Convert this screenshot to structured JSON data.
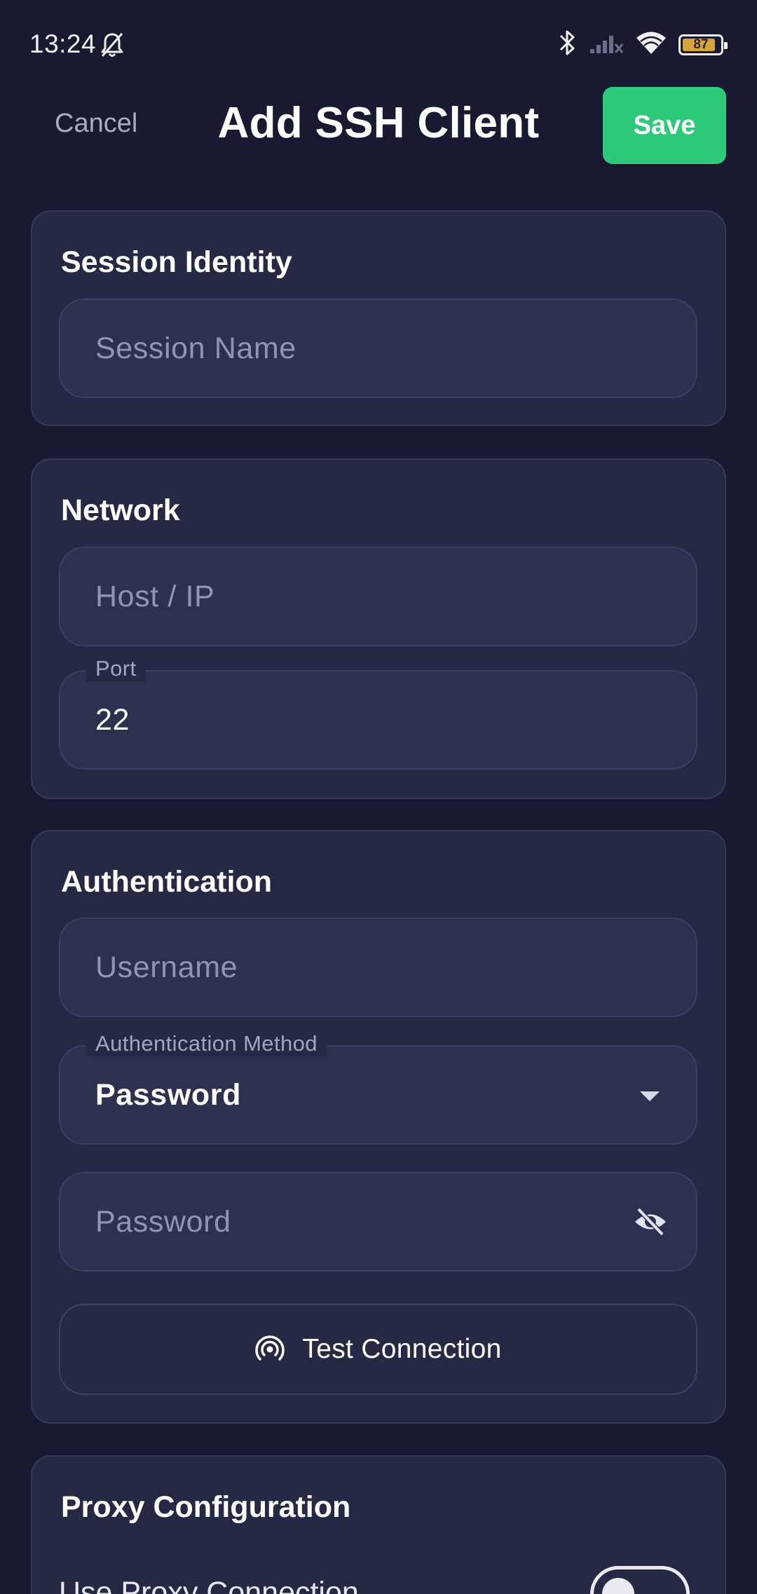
{
  "status_bar": {
    "time": "13:24",
    "battery": "87",
    "icons": [
      "bell-off-icon",
      "bluetooth-icon",
      "signal-icon",
      "wifi-icon",
      "battery-icon"
    ]
  },
  "header": {
    "cancel_label": "Cancel",
    "title": "Add SSH Client",
    "save_label": "Save"
  },
  "session_identity": {
    "title": "Session Identity",
    "session_name_placeholder": "Session Name"
  },
  "network": {
    "title": "Network",
    "host_placeholder": "Host / IP",
    "port_label": "Port",
    "port_value": "22"
  },
  "authentication": {
    "title": "Authentication",
    "username_placeholder": "Username",
    "method_label": "Authentication Method",
    "method_value": "Password",
    "password_placeholder": "Password",
    "test_label": "Test Connection"
  },
  "proxy": {
    "title": "Proxy Configuration",
    "use_proxy_label": "Use Proxy Connection",
    "use_proxy_enabled": false
  },
  "colors": {
    "background": "#171a30",
    "card": "#262944",
    "field": "#2d3150",
    "accent": "#2ec97a"
  }
}
